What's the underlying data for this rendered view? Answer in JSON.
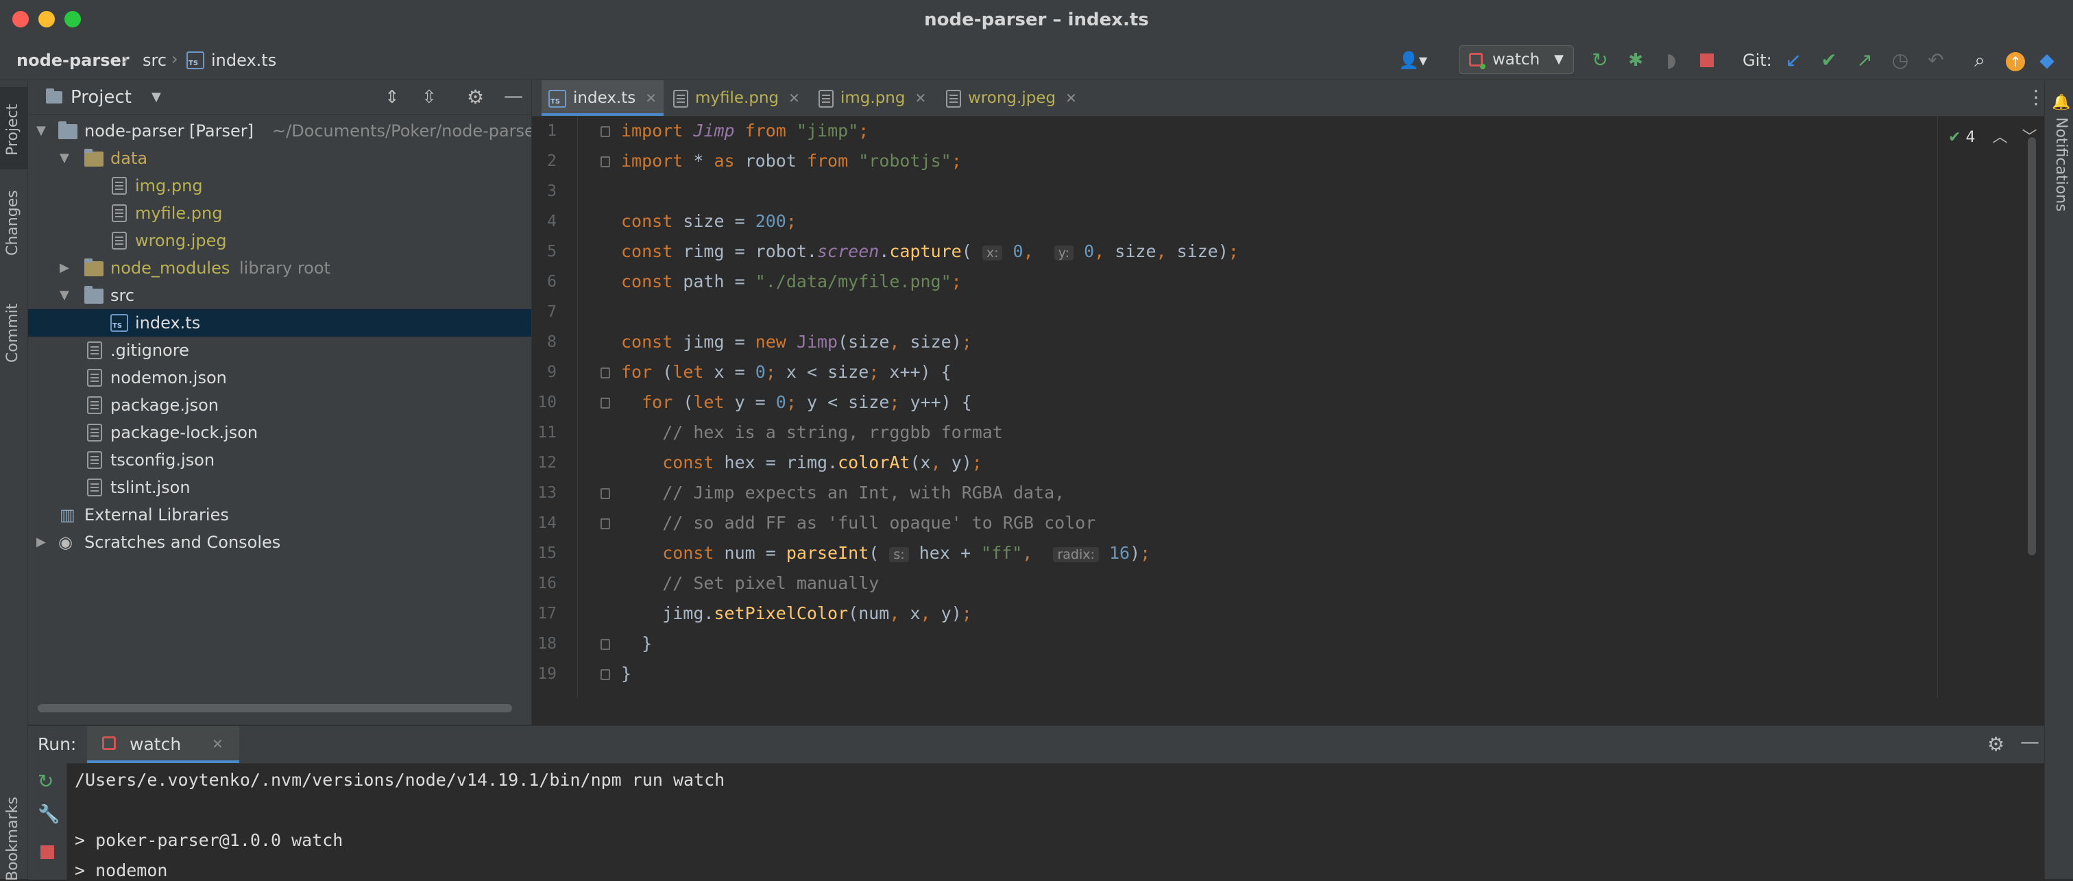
{
  "window": {
    "title": "node-parser – index.ts"
  },
  "breadcrumb": {
    "project": "node-parser",
    "folder": "src",
    "file": "index.ts"
  },
  "toolbar": {
    "run_config": "watch",
    "git_label": "Git:"
  },
  "left_strip": {
    "project": "Project",
    "changes": "Changes",
    "commit": "Commit",
    "bookmarks": "Bookmarks"
  },
  "right_strip": {
    "notifications": "Notifications"
  },
  "project_panel": {
    "title": "Project",
    "tree": {
      "root_name": "node-parser [Parser]",
      "root_path": "~/Documents/Poker/node-parser",
      "data": "data",
      "img": "img.png",
      "myfile": "myfile.png",
      "wrong": "wrong.jpeg",
      "node_modules": "node_modules",
      "node_modules_note": "library root",
      "src": "src",
      "index": "index.ts",
      "gitignore": ".gitignore",
      "nodemon": "nodemon.json",
      "package": "package.json",
      "package_lock": "package-lock.json",
      "tsconfig": "tsconfig.json",
      "tslint": "tslint.json",
      "external": "External Libraries",
      "scratches": "Scratches and Consoles"
    }
  },
  "editor": {
    "tabs": [
      "index.ts",
      "myfile.png",
      "img.png",
      "wrong.jpeg"
    ],
    "inspection_count": "4",
    "line_numbers": [
      "1",
      "2",
      "3",
      "4",
      "5",
      "6",
      "7",
      "8",
      "9",
      "10",
      "11",
      "12",
      "13",
      "14",
      "15",
      "16",
      "17",
      "18",
      "19"
    ],
    "hints": {
      "x": "x:",
      "y": "y:",
      "s": "s:",
      "radix": "radix:"
    }
  },
  "run_panel": {
    "label": "Run:",
    "tab": "watch",
    "lines": [
      "/Users/e.voytenko/.nvm/versions/node/v14.19.1/bin/npm run watch",
      "",
      "> poker-parser@1.0.0 watch",
      "> nodemon"
    ]
  },
  "colors": {
    "accent": "#4a88c7",
    "keyword": "#cc7832",
    "string": "#6a8759",
    "number": "#6897bb",
    "function": "#ffc66d",
    "comment": "#808080"
  }
}
